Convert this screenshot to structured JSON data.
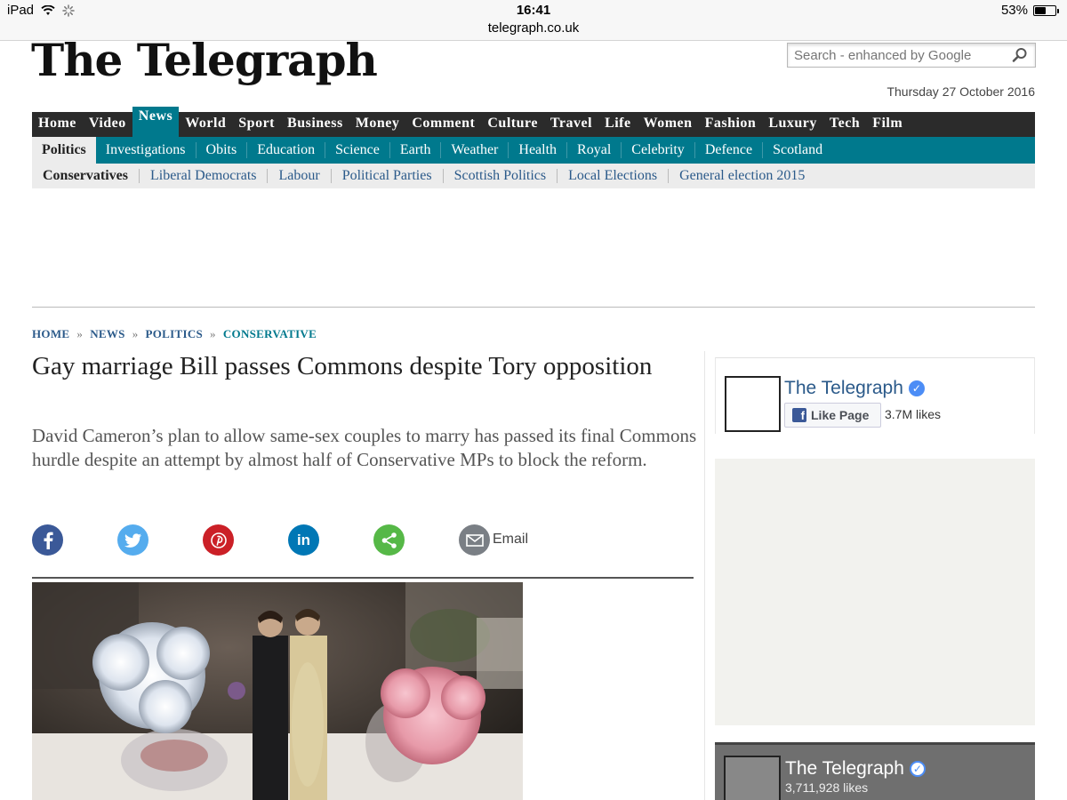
{
  "status_bar": {
    "device": "iPad",
    "time": "16:41",
    "url": "telegraph.co.uk",
    "battery": "53%",
    "battery_level": 0.53
  },
  "masthead": {
    "logo": "The Telegraph",
    "search_placeholder": "Search - enhanced by Google",
    "date": "Thursday 27 October 2016"
  },
  "nav_primary": [
    {
      "label": "Home",
      "active": false
    },
    {
      "label": "Video",
      "active": false
    },
    {
      "label": "News",
      "active": true
    },
    {
      "label": "World",
      "active": false
    },
    {
      "label": "Sport",
      "active": false
    },
    {
      "label": "Business",
      "active": false
    },
    {
      "label": "Money",
      "active": false
    },
    {
      "label": "Comment",
      "active": false
    },
    {
      "label": "Culture",
      "active": false
    },
    {
      "label": "Travel",
      "active": false
    },
    {
      "label": "Life",
      "active": false
    },
    {
      "label": "Women",
      "active": false
    },
    {
      "label": "Fashion",
      "active": false
    },
    {
      "label": "Luxury",
      "active": false
    },
    {
      "label": "Tech",
      "active": false
    },
    {
      "label": "Film",
      "active": false
    }
  ],
  "nav_secondary": [
    {
      "label": "Politics",
      "active": true
    },
    {
      "label": "Investigations",
      "active": false
    },
    {
      "label": "Obits",
      "active": false
    },
    {
      "label": "Education",
      "active": false
    },
    {
      "label": "Science",
      "active": false
    },
    {
      "label": "Earth",
      "active": false
    },
    {
      "label": "Weather",
      "active": false
    },
    {
      "label": "Health",
      "active": false
    },
    {
      "label": "Royal",
      "active": false
    },
    {
      "label": "Celebrity",
      "active": false
    },
    {
      "label": "Defence",
      "active": false
    },
    {
      "label": "Scotland",
      "active": false
    }
  ],
  "nav_tertiary": [
    {
      "label": "Conservatives",
      "active": true
    },
    {
      "label": "Liberal Democrats",
      "active": false
    },
    {
      "label": "Labour",
      "active": false
    },
    {
      "label": "Political Parties",
      "active": false
    },
    {
      "label": "Scottish Politics",
      "active": false
    },
    {
      "label": "Local Elections",
      "active": false
    },
    {
      "label": "General election 2015",
      "active": false
    }
  ],
  "breadcrumb": [
    "HOME",
    "NEWS",
    "POLITICS",
    "CONSERVATIVE"
  ],
  "breadcrumb_separator": "»",
  "article": {
    "headline": "Gay marriage Bill passes Commons despite Tory opposition",
    "standfirst": "David Cameron’s plan to allow same-sex couples to marry has passed its final Commons hurdle despite an attempt by almost half of Conservative MPs to block the reform."
  },
  "share": {
    "buttons": [
      {
        "name": "facebook",
        "color": "#3b5998"
      },
      {
        "name": "twitter",
        "color": "#55acee"
      },
      {
        "name": "pinterest",
        "color": "#cb2027"
      },
      {
        "name": "linkedin",
        "color": "#0077b5"
      },
      {
        "name": "share",
        "color": "#56b847"
      },
      {
        "name": "email",
        "color": "#7a7f85"
      }
    ],
    "email_label": "Email"
  },
  "sidebar": {
    "fb_widget": {
      "page_name": "The Telegraph",
      "like_button": "Like Page",
      "likes": "3.7M likes"
    },
    "fb_banner": {
      "page_name": "The Telegraph",
      "likes": "3,711,928 likes"
    }
  },
  "colors": {
    "nav_dark": "#2b2b2b",
    "accent_teal": "#00798d",
    "link_blue": "#2b5a8a"
  }
}
